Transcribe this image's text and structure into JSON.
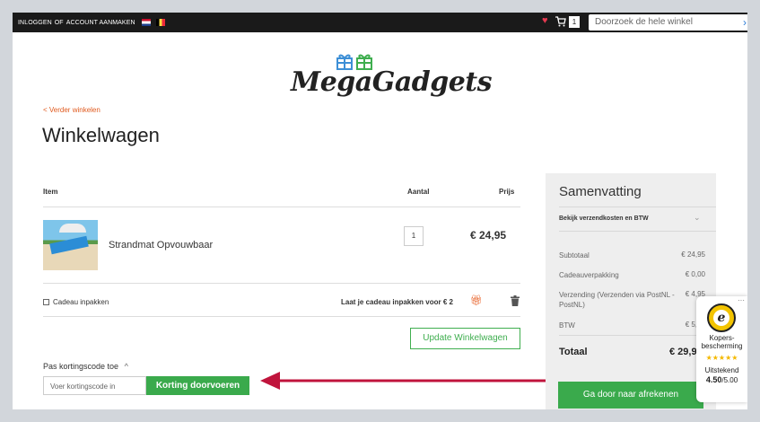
{
  "topbar": {
    "login": "INLOGGEN",
    "or": "OF",
    "create_account": "ACCOUNT AANMAKEN",
    "cart_count": "1",
    "search_placeholder": "Doorzoek de hele winkel"
  },
  "logo": {
    "text": "MegaGadgets"
  },
  "back_link": "< Verder winkelen",
  "page_title": "Winkelwagen",
  "table": {
    "headers": {
      "item": "Item",
      "qty": "Aantal",
      "price": "Prijs"
    },
    "rows": [
      {
        "name": "Strandmat Opvouwbaar",
        "qty": "1",
        "price": "€ 24,95"
      }
    ]
  },
  "gift": {
    "checkbox_label": "Cadeau inpakken",
    "offer_text": "Laat je cadeau inpakken voor € 2"
  },
  "update_button": "Update Winkelwagen",
  "coupon": {
    "label": "Pas kortingscode toe",
    "chevron": "^",
    "placeholder": "Voer kortingscode in",
    "button": "Korting doorvoeren"
  },
  "summary": {
    "title": "Samenvatting",
    "shipping_toggle": "Bekijk verzendkosten en BTW",
    "lines": [
      {
        "label": "Subtotaal",
        "value": "€ 24,95"
      },
      {
        "label": "Cadeauverpakking",
        "value": "€ 0,00"
      },
      {
        "label": "Verzending (Verzenden via PostNL - PostNL)",
        "value": "€ 4,95"
      },
      {
        "label": "BTW",
        "value": "€ 5,19"
      }
    ],
    "total_label": "Totaal",
    "total_value": "€ 29,9",
    "checkout_button": "Ga door naar afrekenen"
  },
  "trust_badge": {
    "line1": "Kopers-bescherming",
    "rating_label": "Uitstekend",
    "score": "4.50",
    "score_max": "/5.00"
  },
  "colors": {
    "accent_green": "#3aaa4c",
    "link_orange": "#e05a1e",
    "arrow_red": "#c0143c",
    "topbar": "#1a1a1a"
  }
}
